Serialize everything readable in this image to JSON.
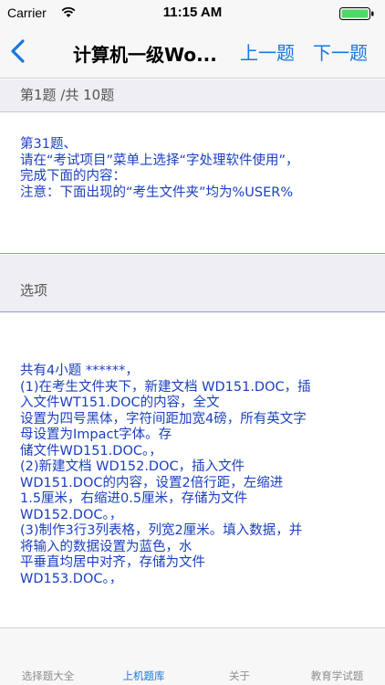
{
  "status_bar": {
    "carrier": "Carrier",
    "time": "11:15 AM"
  },
  "nav": {
    "title": "计算机一级Wo...",
    "prev_label": "上一题",
    "next_label": "下一题"
  },
  "progress": {
    "text": "第1题 /共 10题"
  },
  "question": {
    "lines": [
      "第31题、",
      "请在“考试项目”菜单上选择“字处理软件使用”，",
      "完成下面的内容：",
      "注意：下面出现的“考生文件夹”均为%USER%"
    ]
  },
  "options": {
    "header": "选项",
    "lines": [
      "共有4小题 ******，",
      "(1)在考生文件夹下，新建文档 WD151.DOC，插",
      "入文件WT151.DOC的内容，全文",
      "设置为四号黑体，字符间距加宽4磅，所有英文字",
      "母设置为Impact字体。存",
      "储文件WD151.DOC。，",
      "(2)新建文档 WD152.DOC，插入文件",
      "WD151.DOC的内容，设置2倍行距，左缩进",
      "1.5厘米，右缩进0.5厘米，存储为文件",
      "WD152.DOC。，",
      "(3)制作3行3列表格，列宽2厘米。填入数据，并",
      "将输入的数据设置为蓝色，水",
      "平垂直均居中对齐，存储为文件",
      "WD153.DOC。，"
    ]
  },
  "tabs": [
    {
      "label": "选择题大全"
    },
    {
      "label": "上机题库"
    },
    {
      "label": "关于"
    },
    {
      "label": "教育学试题"
    }
  ],
  "colors": {
    "accent": "#1877e0",
    "content_text": "#1a3fbf"
  }
}
